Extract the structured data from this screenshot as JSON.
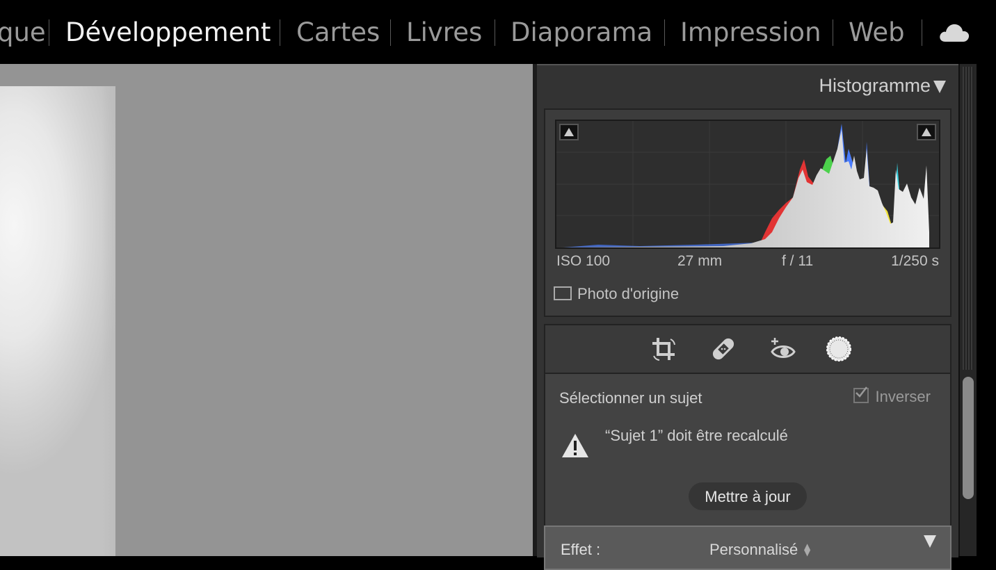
{
  "modules": [
    {
      "label": "que",
      "active": false
    },
    {
      "label": "Développement",
      "active": true
    },
    {
      "label": "Cartes",
      "active": false
    },
    {
      "label": "Livres",
      "active": false
    },
    {
      "label": "Diaporama",
      "active": false
    },
    {
      "label": "Impression",
      "active": false
    },
    {
      "label": "Web",
      "active": false
    }
  ],
  "cloud_icon": "cloud-icon",
  "histogram": {
    "title": "Histogramme",
    "iso": "ISO 100",
    "focal": "27 mm",
    "aperture": "f / 11",
    "shutter": "1/250 s",
    "original_label": "Photo d'origine",
    "colors": {
      "red": "#e23434",
      "green": "#4cd24c",
      "blue": "#4a7dff",
      "yellow": "#f0e23a",
      "cyan": "#38d8e8",
      "magenta": "#e040e0",
      "white": "#e4e4e4"
    }
  },
  "tools": [
    "crop-icon",
    "healing-icon",
    "red-eye-icon",
    "masking-icon"
  ],
  "mask": {
    "select_subject": "Sélectionner un sujet",
    "invert_label": "Inverser",
    "invert_checked": true,
    "warning": "“Sujet 1” doit être recalculé",
    "update_button": "Mettre à jour"
  },
  "effect": {
    "label": "Effet :",
    "value": "Personnalisé"
  }
}
